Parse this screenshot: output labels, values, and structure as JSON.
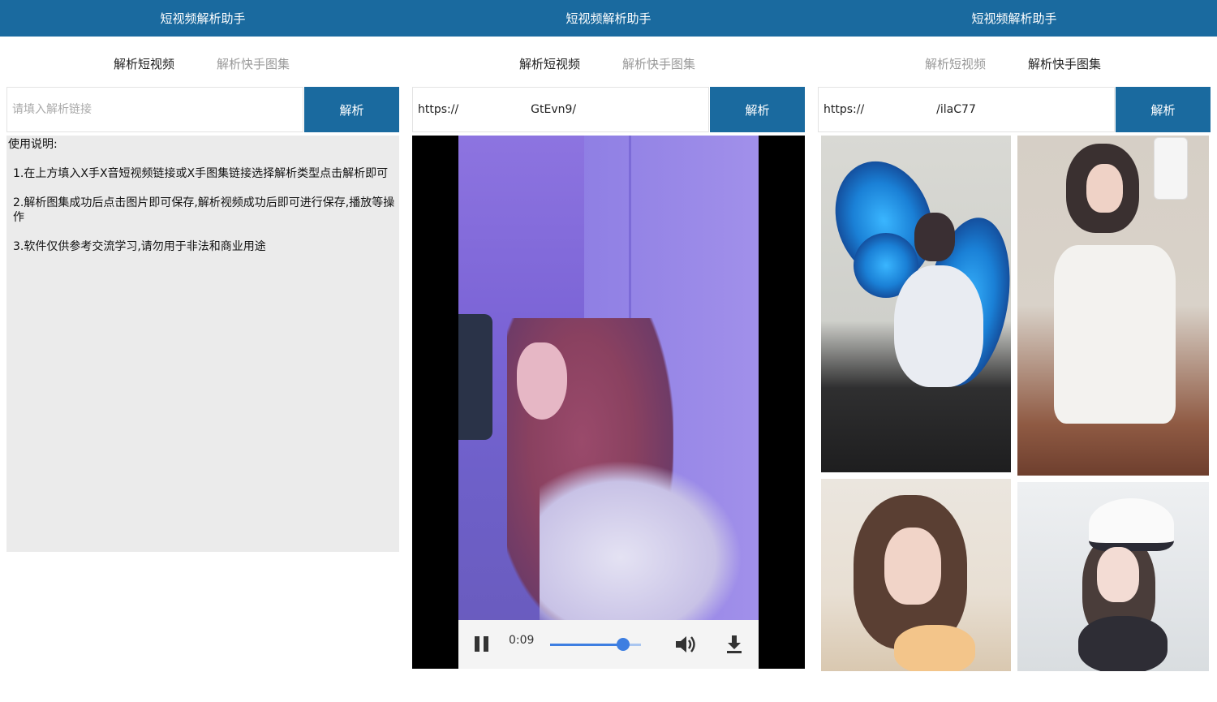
{
  "colors": {
    "accent": "#1a6a9f",
    "panel_bg": "#ebebeb"
  },
  "panels": [
    {
      "app_title": "短视频解析助手",
      "tabs": [
        "解析短视频",
        "解析快手图集"
      ],
      "active_tab": 0,
      "input": {
        "value": "",
        "placeholder": "请填入解析链接"
      },
      "parse_button": "解析",
      "instructions": {
        "heading": "使用说明:",
        "steps": [
          "1.在上方填入X手X音短视频链接或X手图集链接选择解析类型点击解析即可",
          "2.解析图集成功后点击图片即可保存,解析视频成功后即可进行保存,播放等操作",
          "3.软件仅供参考交流学习,请勿用于非法和商业用途"
        ]
      }
    },
    {
      "app_title": "短视频解析助手",
      "tabs": [
        "解析短视频",
        "解析快手图集"
      ],
      "active_tab": 0,
      "input": {
        "value": "https://                    GtEvn9/",
        "placeholder": "请填入解析链接"
      },
      "parse_button": "解析",
      "video": {
        "time": "0:09",
        "progress": 0.8,
        "icons": [
          "pause-icon",
          "volume-icon",
          "download-icon"
        ]
      }
    },
    {
      "app_title": "短视频解析助手",
      "tabs": [
        "解析短视频",
        "解析快手图集"
      ],
      "active_tab": 1,
      "input": {
        "value": "https://                    /ilaC77",
        "placeholder": "请填入解析链接"
      },
      "parse_button": "解析",
      "gallery": {
        "image_count": 4
      }
    }
  ]
}
